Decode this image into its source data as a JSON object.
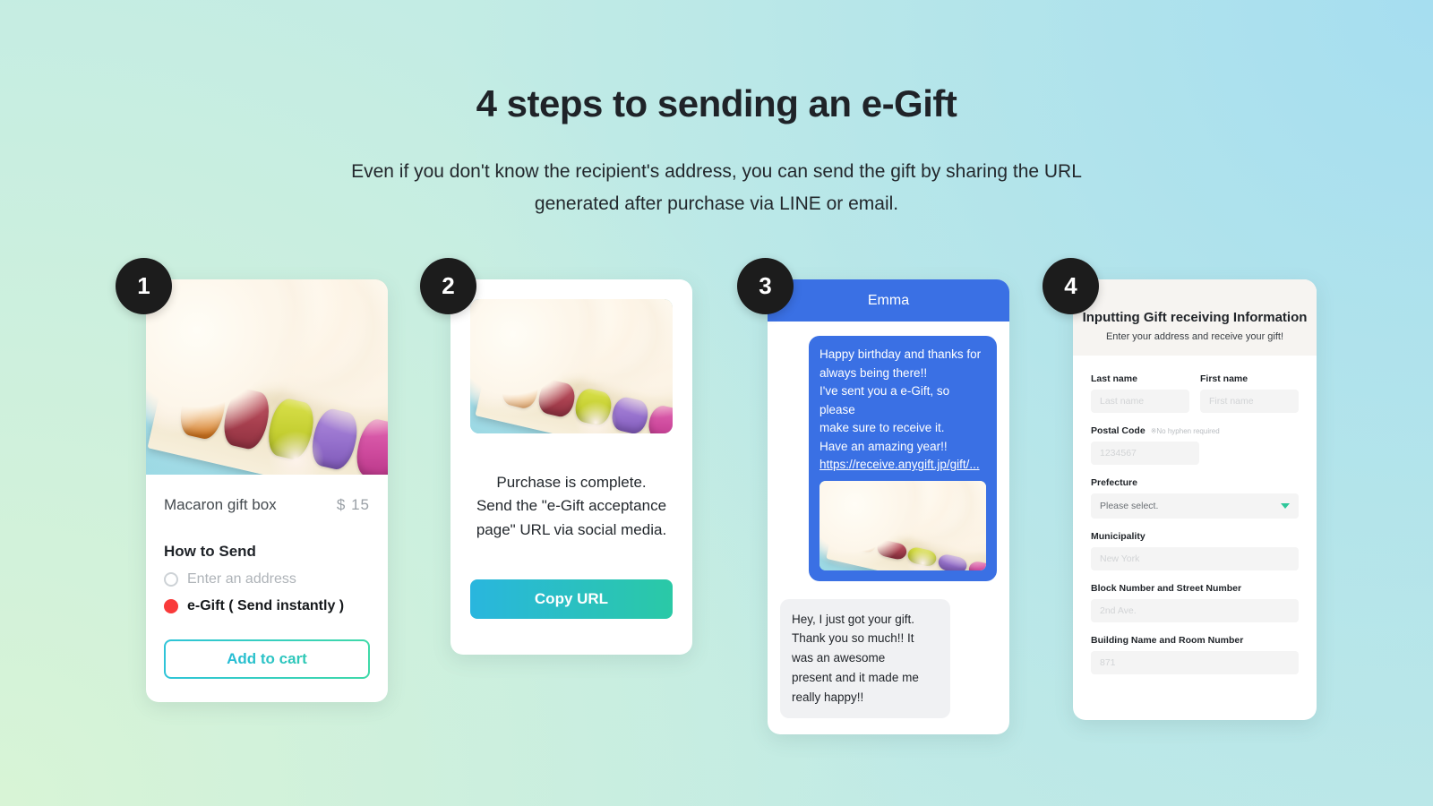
{
  "header": {
    "title": "4 steps to sending an e-Gift",
    "subtitle_line1": "Even if you don't know the recipient's address, you can send the gift by sharing the URL",
    "subtitle_line2": "generated after purchase via LINE or email."
  },
  "colors": {
    "badge": "#1c1c1c",
    "accent_teal": "#2ec4d8",
    "accent_green": "#3fd9a8",
    "chat_blue": "#3a70e4",
    "radio_selected": "#f93a3a"
  },
  "steps": [
    {
      "number": "1",
      "product_name": "Macaron gift box",
      "product_price": "$ 15",
      "how_to_send_label": "How to Send",
      "options": [
        {
          "label": "Enter an address",
          "selected": false
        },
        {
          "label": "e-Gift ( Send instantly )",
          "selected": true
        }
      ],
      "cta_label": "Add to cart"
    },
    {
      "number": "2",
      "message_line1": "Purchase is complete.",
      "message_line2": "Send the \"e-Gift acceptance",
      "message_line3": "page\" URL via social media.",
      "cta_label": "Copy URL"
    },
    {
      "number": "3",
      "chat_title": "Emma",
      "outgoing_message": {
        "line1": "Happy birthday and thanks for",
        "line2": "always being there!!",
        "line3": "I've sent you a e-Gift, so please",
        "line4": "make sure to receive it.",
        "line5": "Have an amazing year!!",
        "link": "https://receive.anygift.jp/gift/..."
      },
      "incoming_message": {
        "line1": "Hey, I just got your gift.",
        "line2": "Thank you so much!! It",
        "line3": "was an awesome",
        "line4": "present and it made me",
        "line5": "really happy!!"
      }
    },
    {
      "number": "4",
      "form_title": "Inputting Gift receiving Information",
      "form_subtitle": "Enter your address and receive your gift!",
      "fields": [
        {
          "label": "Last name",
          "note": "",
          "placeholder": "Last name",
          "type": "text"
        },
        {
          "label": "First name",
          "note": "",
          "placeholder": "First name",
          "type": "text"
        },
        {
          "label": "Postal Code",
          "note": "※No hyphen required",
          "placeholder": "1234567",
          "type": "text"
        },
        {
          "label": "Prefecture",
          "note": "",
          "placeholder": "Please select.",
          "type": "select"
        },
        {
          "label": "Municipality",
          "note": "",
          "placeholder": "New York",
          "type": "text"
        },
        {
          "label": "Block Number and Street Number",
          "note": "",
          "placeholder": "2nd Ave.",
          "type": "text"
        },
        {
          "label": "Building Name and Room Number",
          "note": "",
          "placeholder": "871",
          "type": "text"
        }
      ]
    }
  ]
}
